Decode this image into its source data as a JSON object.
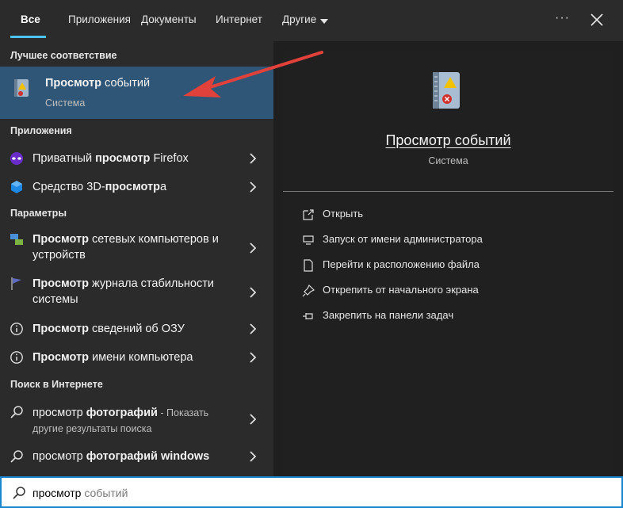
{
  "tabs": [
    {
      "label": "Все",
      "active": true
    },
    {
      "label": "Приложения"
    },
    {
      "label": "Документы"
    },
    {
      "label": "Интернет"
    },
    {
      "label": "Другие"
    }
  ],
  "header": {
    "more_label": "···"
  },
  "sections": {
    "best_match": "Лучшее соответствие",
    "apps": "Приложения",
    "settings": "Параметры",
    "web": "Поиск в Интернете"
  },
  "best": {
    "title_bold": "Просмотр",
    "title_rest": " событий",
    "subtitle": "Система"
  },
  "apps": [
    {
      "pre": "Приватный ",
      "bold": "просмотр",
      "post": " Firefox",
      "icon": "firefox-private-icon"
    },
    {
      "pre": "Средство 3D-",
      "bold": "просмотр",
      "post": "а",
      "icon": "3d-viewer-icon"
    }
  ],
  "settings": [
    {
      "bold": "Просмотр",
      "post": " сетевых компьютеров и",
      "line2": "устройств",
      "icon": "network-icon"
    },
    {
      "bold": "Просмотр",
      "post": " журнала стабильности",
      "line2": "системы",
      "icon": "flag-icon"
    },
    {
      "bold": "Просмотр",
      "post": " сведений об ОЗУ",
      "icon": "info-icon"
    },
    {
      "bold": "Просмотр",
      "post": " имени компьютера",
      "icon": "info-icon"
    }
  ],
  "web": [
    {
      "pre": "просмотр ",
      "bold": "фотографий",
      "post": " - Показать",
      "line2": "другие результаты поиска",
      "icon": "search-icon"
    },
    {
      "pre": "просмотр ",
      "bold": "фотографий windows",
      "post": "",
      "icon": "search-icon"
    }
  ],
  "preview": {
    "title": "Просмотр событий",
    "subtitle": "Система"
  },
  "actions": [
    {
      "label": "Открыть",
      "icon": "open-icon"
    },
    {
      "label": "Запуск от имени администратора",
      "icon": "shield-icon"
    },
    {
      "label": "Перейти к расположению файла",
      "icon": "file-location-icon"
    },
    {
      "label": "Открепить от начального экрана",
      "icon": "unpin-icon"
    },
    {
      "label": "Закрепить на панели задач",
      "icon": "pin-icon"
    }
  ],
  "search": {
    "typed": "просмотр",
    "hint": " событий"
  },
  "colors": {
    "accent": "#4cc2ff",
    "selection": "#2f5676",
    "annotation_arrow": "#e0413a"
  }
}
